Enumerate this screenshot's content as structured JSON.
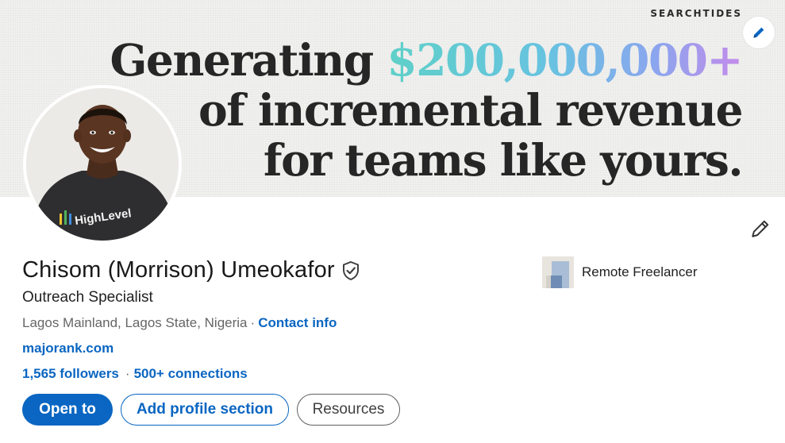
{
  "banner": {
    "brand": "SEARCHTIDES",
    "line1_prefix": "Generating",
    "amount": "$200,000,000+",
    "line2": "of incremental revenue",
    "line3": "for teams like yours."
  },
  "avatar": {
    "shirt_text": "HighLevel"
  },
  "profile": {
    "name": "Chisom (Morrison) Umeokafor",
    "headline": "Outreach Specialist",
    "location": "Lagos Mainland, Lagos State, Nigeria",
    "location_separator": "·",
    "contact_info": "Contact info",
    "website": "majorank.com",
    "followers": "1,565 followers",
    "network_separator": "·",
    "connections": "500+ connections"
  },
  "actions": {
    "open_to": "Open to",
    "add_section": "Add profile section",
    "resources": "Resources"
  },
  "experience": {
    "company": "Remote Freelancer"
  },
  "icons": {
    "banner_edit": "pencil-icon",
    "intro_edit": "pencil-icon",
    "verified": "verified-shield-icon"
  },
  "colors": {
    "primary": "#0a66c2",
    "gradient_start": "#5fd0c8",
    "gradient_end": "#c48bea"
  }
}
